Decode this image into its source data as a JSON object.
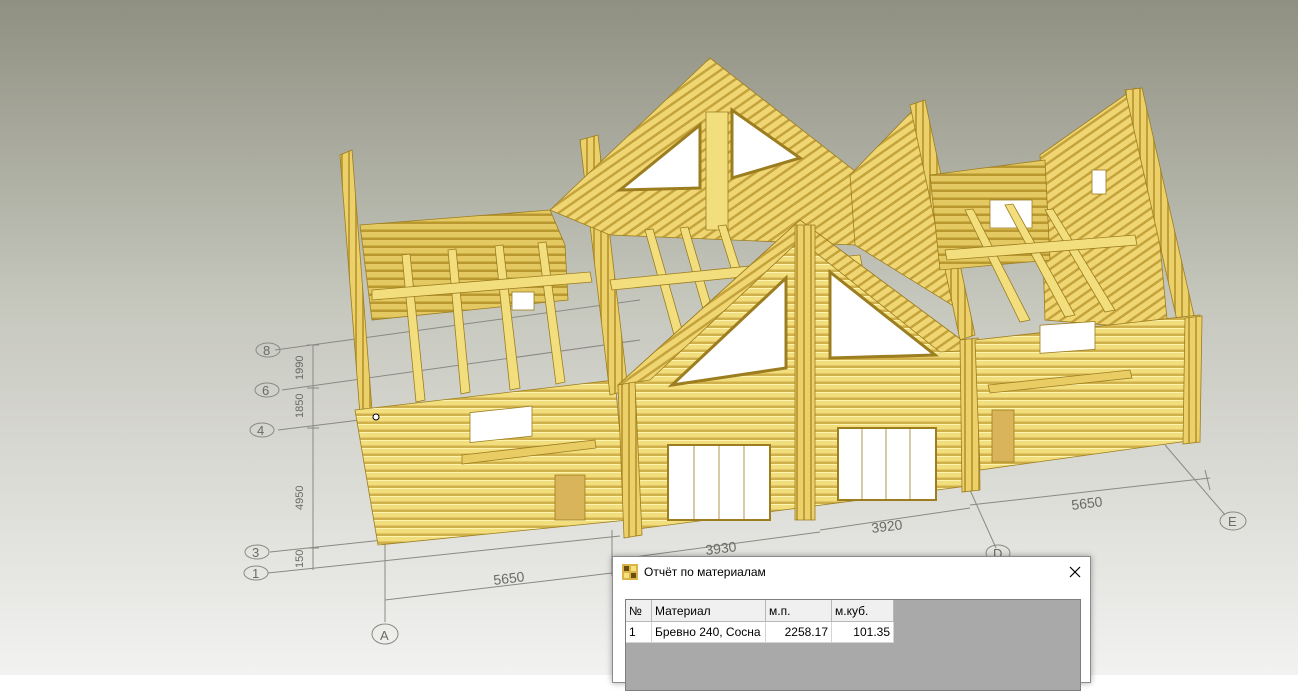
{
  "viewport": {
    "axes_numbers": [
      "1",
      "3",
      "4",
      "6",
      "8"
    ],
    "axes_letters": [
      "A",
      "D",
      "E"
    ],
    "dims_bottom": [
      "5650",
      "3930",
      "3920",
      "5650"
    ],
    "dims_left": [
      "150",
      "4950",
      "1850",
      "1990"
    ]
  },
  "dialog": {
    "title": "Отчёт по материалам",
    "table": {
      "headers": [
        "№",
        "Материал",
        "м.п.",
        "м.куб."
      ],
      "rows": [
        {
          "no": "1",
          "material": "Бревно 240, Сосна",
          "mp": "2258.17",
          "volume": "101.35"
        }
      ]
    }
  },
  "colors": {
    "wood": "#f3de7d",
    "wood_shade": "#c9a93c",
    "background_top": "#8f9081",
    "background_bottom": "#f2f2f1"
  }
}
